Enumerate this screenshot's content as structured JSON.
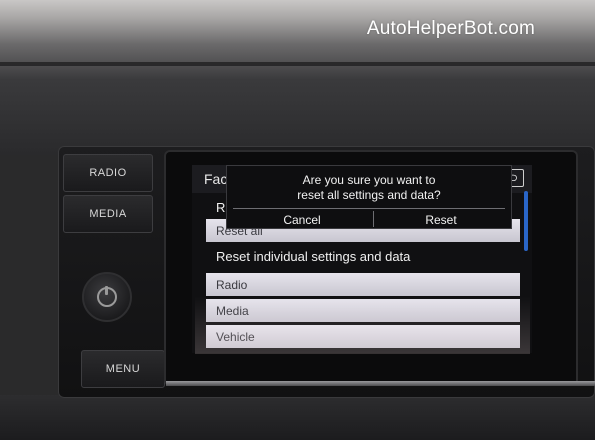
{
  "watermark": "AutoHelperBot.com",
  "hardware_buttons": {
    "radio": "RADIO",
    "media": "MEDIA",
    "menu": "MENU"
  },
  "screen": {
    "title_partial": "Fac",
    "list": [
      {
        "label": "R"
      },
      {
        "label": "Reset all"
      },
      {
        "label": "Reset individual settings and data"
      },
      {
        "label": "Radio"
      },
      {
        "label": "Media"
      },
      {
        "label": "Vehicle"
      }
    ],
    "scrollbar_color": "#2a66c8"
  },
  "dialog": {
    "line1": "Are you sure you want to",
    "line2": "reset all settings and data?",
    "cancel": "Cancel",
    "reset": "Reset"
  }
}
